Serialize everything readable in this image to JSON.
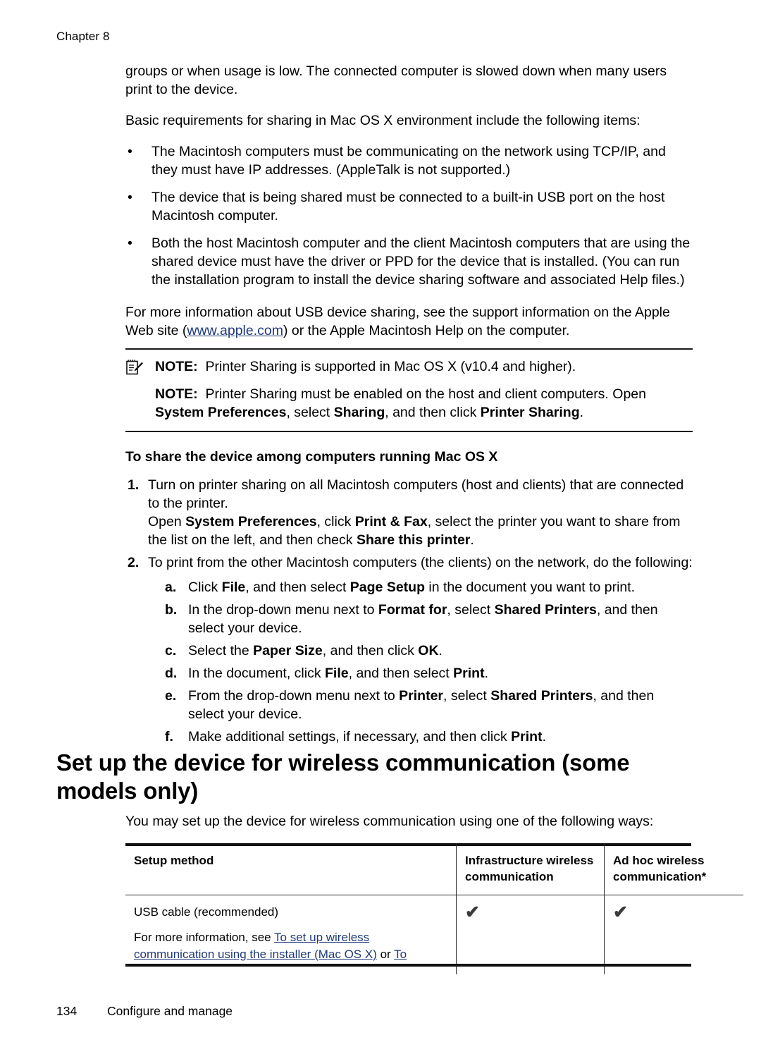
{
  "header": {
    "chapter": "Chapter 8"
  },
  "body": {
    "para1": "groups or when usage is low. The connected computer is slowed down when many users print to the device.",
    "para2": "Basic requirements for sharing in Mac OS X environment include the following items:",
    "bullets": [
      "The Macintosh computers must be communicating on the network using TCP/IP, and they must have IP addresses. (AppleTalk is not supported.)",
      "The device that is being shared must be connected to a built-in USB port on the host Macintosh computer.",
      "Both the host Macintosh computer and the client Macintosh computers that are using the shared device must have the driver or PPD for the device that is installed. (You can run the installation program to install the device sharing software and associated Help files.)"
    ],
    "bullet_marker": "•",
    "para3_pre": "For more information about USB device sharing, see the support information on the Apple Web site (",
    "para3_link": "www.apple.com",
    "para3_post": ") or the Apple Macintosh Help on the computer."
  },
  "notes": {
    "icon_name": "note-pencil-icon",
    "label": "NOTE:",
    "note1_text": "Printer Sharing is supported in Mac OS X (v10.4 and higher).",
    "note2_part1": "Printer Sharing must be enabled on the host and client computers. Open ",
    "note2_bold1": "System Preferences",
    "note2_part2": ", select ",
    "note2_bold2": "Sharing",
    "note2_part3": ", and then click ",
    "note2_bold3": "Printer Sharing",
    "note2_part4": "."
  },
  "procedure": {
    "title": "To share the device among computers running Mac OS X",
    "step1_marker": "1.",
    "step1_text": "Turn on printer sharing on all Macintosh computers (host and clients) that are connected to the printer.",
    "step1_extra_pre": "Open ",
    "step1_extra_b1": "System Preferences",
    "step1_extra_mid1": ", click ",
    "step1_extra_b2": "Print & Fax",
    "step1_extra_mid2": ", select the printer you want to share from the list on the left, and then check ",
    "step1_extra_b3": "Share this printer",
    "step1_extra_post": ".",
    "step2_marker": "2.",
    "step2_text": "To print from the other Macintosh computers (the clients) on the network, do the following:",
    "substeps": [
      {
        "marker": "a.",
        "pre": "Click ",
        "b1": "File",
        "mid1": ", and then select ",
        "b2": "Page Setup",
        "post": " in the document you want to print."
      },
      {
        "marker": "b.",
        "pre": "In the drop-down menu next to ",
        "b1": "Format for",
        "mid1": ", select ",
        "b2": "Shared Printers",
        "post": ", and then select your device."
      },
      {
        "marker": "c.",
        "pre": "Select the ",
        "b1": "Paper Size",
        "mid1": ", and then click ",
        "b2": "OK",
        "post": "."
      },
      {
        "marker": "d.",
        "pre": "In the document, click ",
        "b1": "File",
        "mid1": ", and then select ",
        "b2": "Print",
        "post": "."
      },
      {
        "marker": "e.",
        "pre": "From the drop-down menu next to ",
        "b1": "Printer",
        "mid1": ", select ",
        "b2": "Shared Printers",
        "post": ", and then select your device."
      },
      {
        "marker": "f.",
        "pre": "Make additional settings, if necessary, and then click ",
        "b1": "Print",
        "mid1": "",
        "b2": "",
        "post": "."
      }
    ]
  },
  "section": {
    "heading": "Set up the device for wireless communication (some models only)",
    "intro": "You may set up the device for wireless communication using one of the following ways:"
  },
  "table": {
    "headers": {
      "method": "Setup method",
      "infrastructure": "Infrastructure wireless communication",
      "adhoc": "Ad hoc wireless communication*"
    },
    "rows": [
      {
        "method_line1": "USB cable (recommended)",
        "method_line2_pre": "For more information, see ",
        "method_line2_link1": "To set up wireless communication using the installer (Mac OS X)",
        "method_line2_mid": " or ",
        "method_line2_link2": "To",
        "infrastructure": "✔",
        "adhoc": "✔"
      }
    ]
  },
  "footer": {
    "page_number": "134",
    "section_name": "Configure and manage"
  },
  "colors": {
    "link": "#1f3a7a",
    "text": "#000000",
    "rule": "#1a1a1a"
  }
}
